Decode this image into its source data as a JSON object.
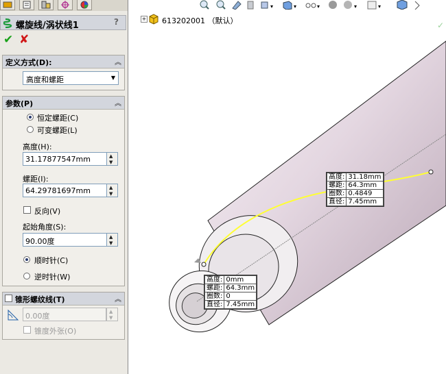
{
  "property_manager": {
    "title": "螺旋线/涡状线1",
    "help": "?",
    "ok_label": "✔",
    "cancel_label": "✘",
    "definition": {
      "header": "定义方式(D):",
      "selected": "高度和螺距"
    },
    "params": {
      "header": "参数(P)",
      "constant_pitch": "恒定螺距(C)",
      "variable_pitch": "可变螺距(L)",
      "height_label": "高度(H):",
      "height_value": "31.17877547mm",
      "pitch_label": "螺距(I):",
      "pitch_value": "64.29781697mm",
      "reverse_label": "反向(V)",
      "start_angle_label": "起始角度(S):",
      "start_angle_value": "90.00度",
      "clockwise": "顺时针(C)",
      "counterclockwise": "逆时针(W)"
    },
    "taper": {
      "header": "锥形螺纹线(T)",
      "angle_value": "0.00度",
      "taper_outward": "锥度外张(O)"
    }
  },
  "viewport": {
    "tree_node": "613202001 （默认）",
    "callout_end": {
      "rows": [
        {
          "label": "高度:",
          "value": "31.18mm"
        },
        {
          "label": "螺距:",
          "value": "64.3mm"
        },
        {
          "label": "圈数:",
          "value": "0.4849"
        },
        {
          "label": "直径:",
          "value": "7.45mm"
        }
      ]
    },
    "callout_start": {
      "rows": [
        {
          "label": "高度:",
          "value": "0mm"
        },
        {
          "label": "螺距:",
          "value": "64.3mm"
        },
        {
          "label": "圈数:",
          "value": "0"
        },
        {
          "label": "直径:",
          "value": "7.45mm"
        }
      ]
    }
  },
  "colors": {
    "helix": "#ffff33",
    "part_body": "#e6dbe3",
    "ok": "#1aa11a",
    "cancel": "#d01818"
  }
}
